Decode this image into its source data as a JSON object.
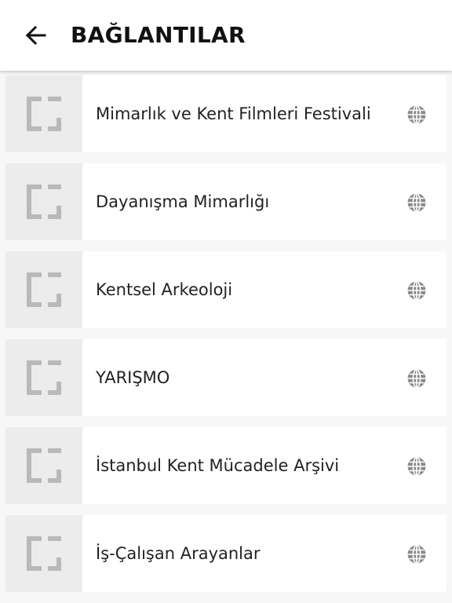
{
  "header": {
    "title": "BAĞLANTILAR",
    "back_icon": "arrow-left-icon"
  },
  "links": [
    {
      "label": "Mimarlık ve Kent Filmleri Festivali",
      "thumb_icon": "bracket-logo-icon",
      "action_icon": "globe-icon"
    },
    {
      "label": "Dayanışma Mimarlığı",
      "thumb_icon": "bracket-logo-icon",
      "action_icon": "globe-icon"
    },
    {
      "label": "Kentsel Arkeoloji",
      "thumb_icon": "bracket-logo-icon",
      "action_icon": "globe-icon"
    },
    {
      "label": "YARIŞMO",
      "thumb_icon": "bracket-logo-icon",
      "action_icon": "globe-icon"
    },
    {
      "label": "İstanbul Kent Mücadele Arşivi",
      "thumb_icon": "bracket-logo-icon",
      "action_icon": "globe-icon"
    },
    {
      "label": "İş-Çalışan Arayanlar",
      "thumb_icon": "bracket-logo-icon",
      "action_icon": "globe-icon"
    }
  ],
  "colors": {
    "background": "#f7f7f7",
    "card": "#ffffff",
    "thumb_bg": "#ececec",
    "thumb_mark": "#b9b9b9",
    "globe": "#8a8a8a",
    "text": "#222222"
  }
}
